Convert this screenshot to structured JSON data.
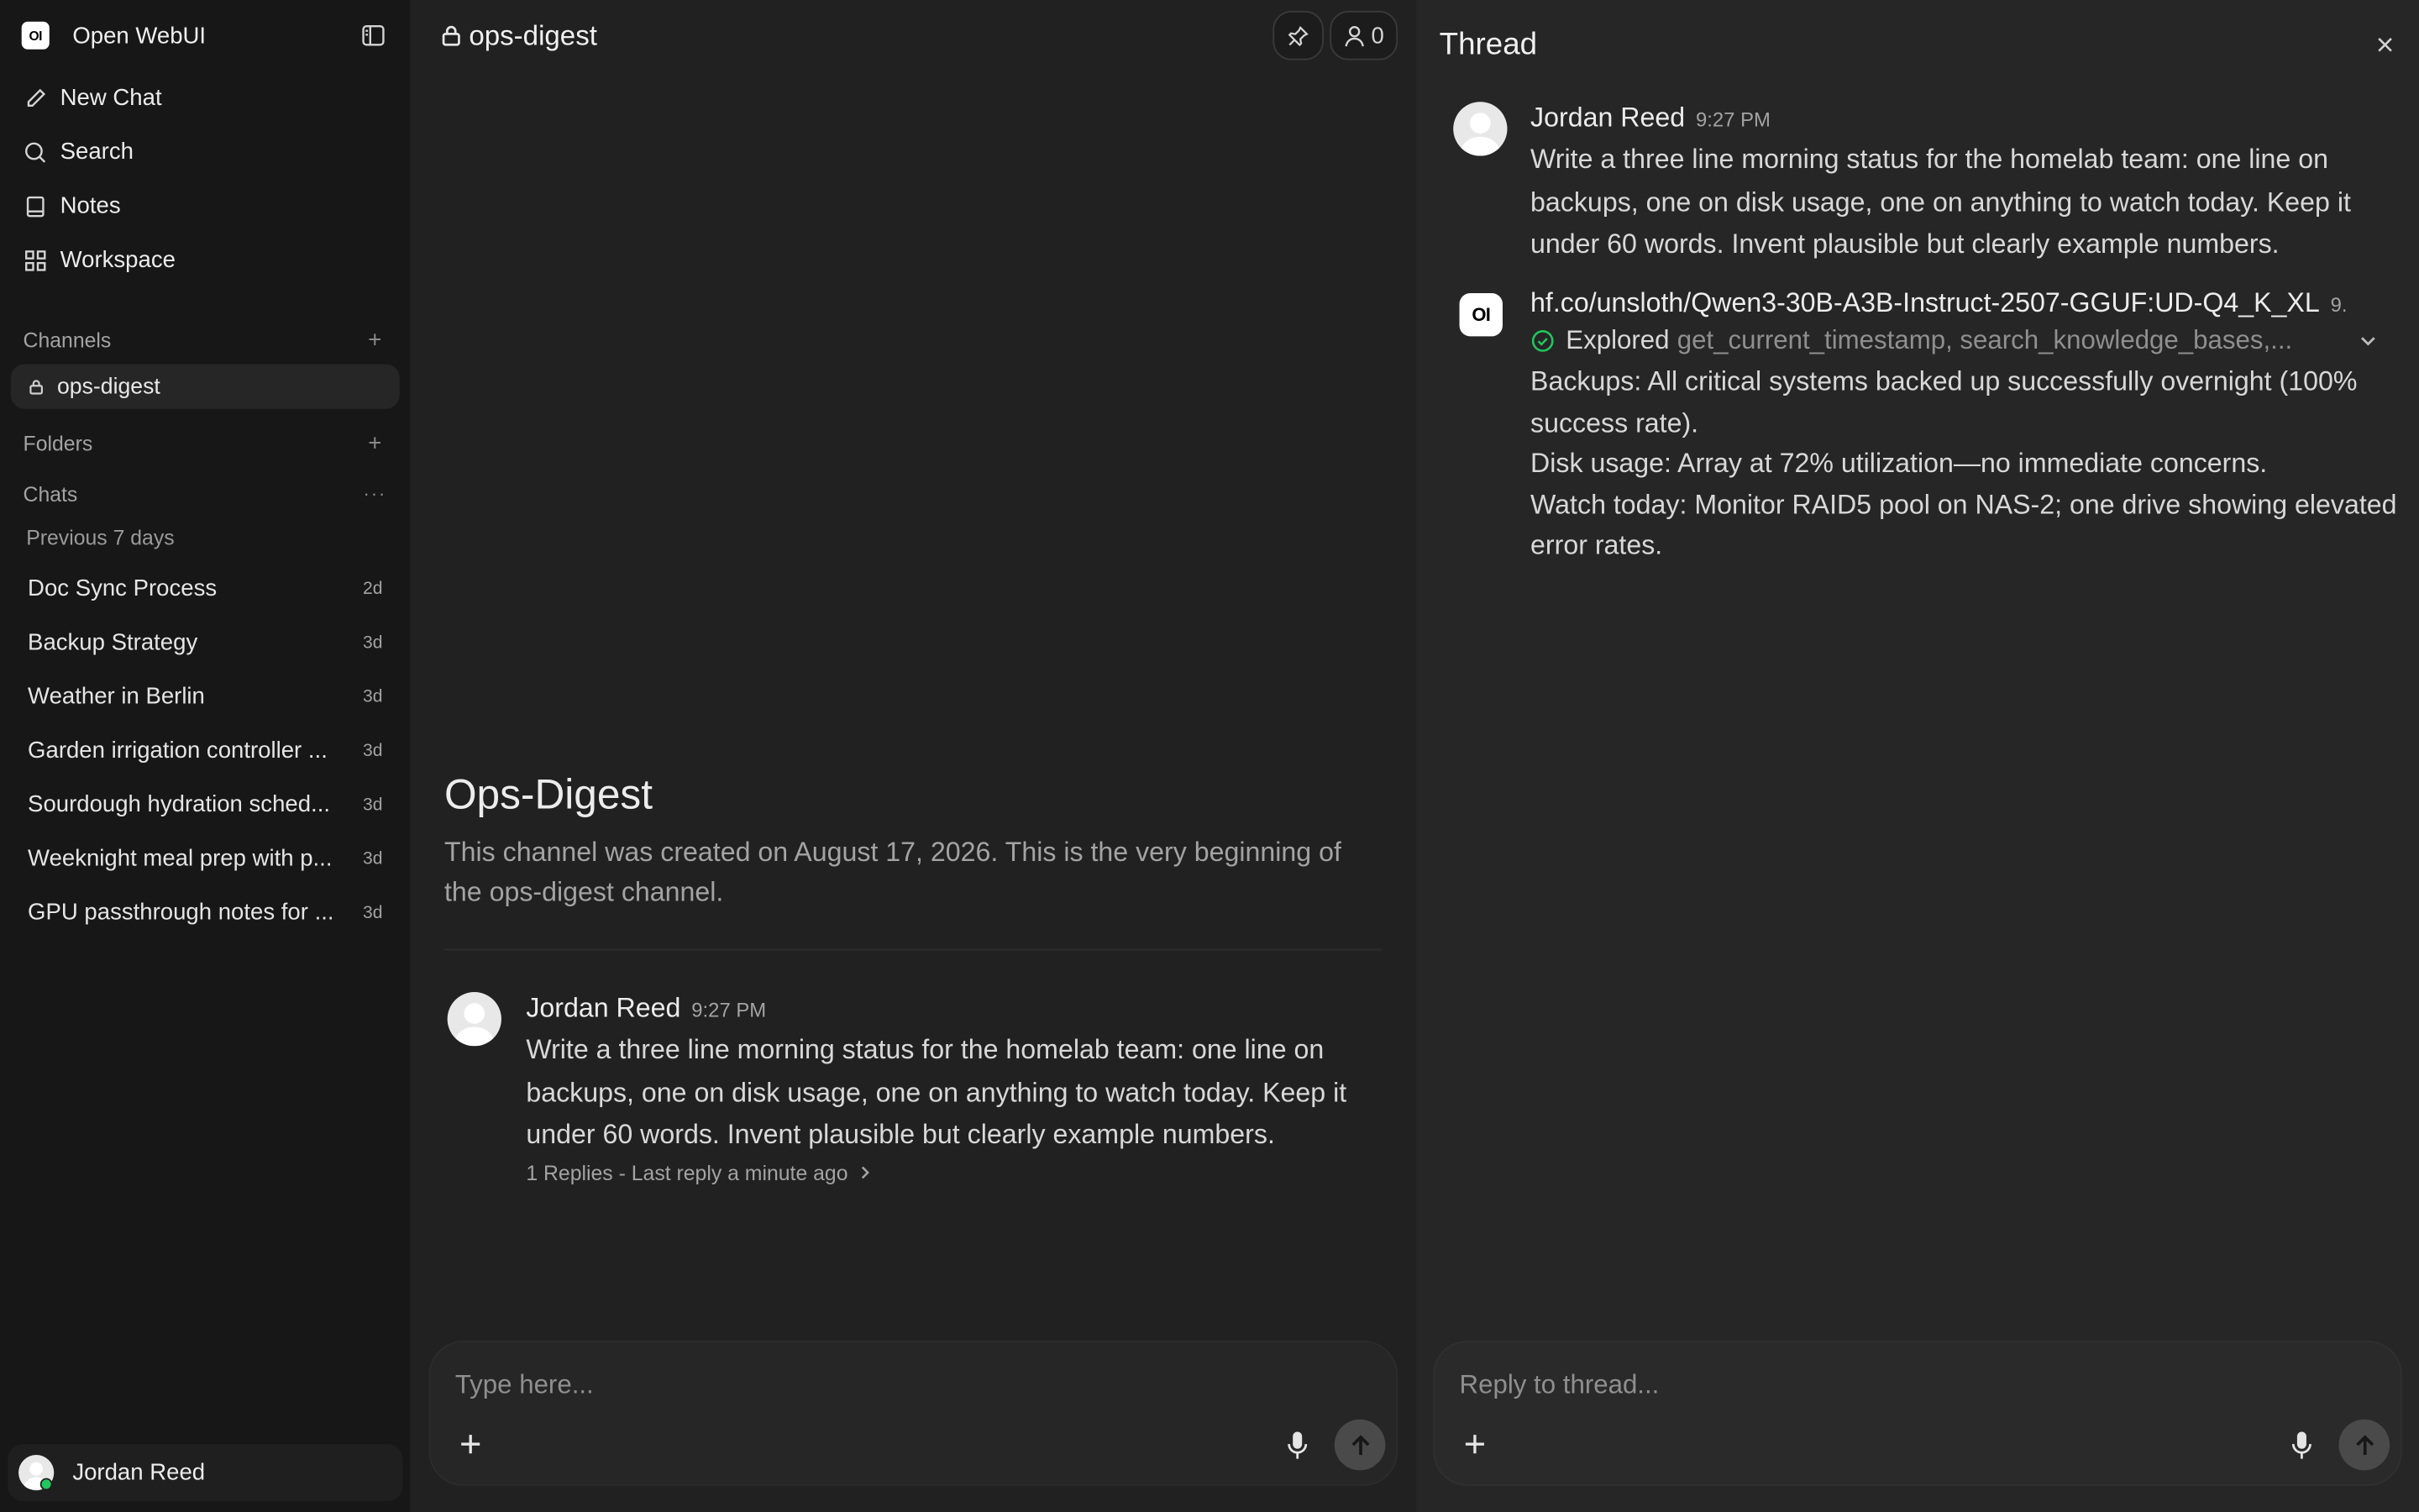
{
  "app": {
    "logo_text": "OI",
    "name": "Open WebUI"
  },
  "sidebar": {
    "nav": [
      {
        "label": "New Chat",
        "icon": "pencil-icon"
      },
      {
        "label": "Search",
        "icon": "search-icon"
      },
      {
        "label": "Notes",
        "icon": "notes-icon"
      },
      {
        "label": "Workspace",
        "icon": "workspace-icon"
      }
    ],
    "channels_label": "Channels",
    "channels": [
      {
        "label": "ops-digest"
      }
    ],
    "folders_label": "Folders",
    "chats_label": "Chats",
    "chat_group": "Previous 7 days",
    "chats": [
      {
        "title": "Doc Sync Process",
        "age": "2d"
      },
      {
        "title": "Backup Strategy",
        "age": "3d"
      },
      {
        "title": "Weather in Berlin",
        "age": "3d"
      },
      {
        "title": "Garden irrigation controller ...",
        "age": "3d"
      },
      {
        "title": "Sourdough hydration sched...",
        "age": "3d"
      },
      {
        "title": "Weeknight meal prep with p...",
        "age": "3d"
      },
      {
        "title": "GPU passthrough notes for ...",
        "age": "3d"
      }
    ],
    "user": {
      "name": "Jordan Reed",
      "status_color": "#22c55e"
    }
  },
  "channel": {
    "name": "ops-digest",
    "members_count": "0",
    "intro_title": "Ops-Digest",
    "intro_text": "This channel was created on August 17, 2026. This is the very beginning of the ops-digest channel.",
    "message": {
      "author": "Jordan Reed",
      "time": "9:27 PM",
      "lines": [
        "Write a three line morning status for the homelab team: one line on",
        "backups, one on disk usage, one on anything to watch today. Keep it",
        "under 60 words. Invent plausible but clearly example numbers."
      ],
      "replies": "1 Replies - Last reply a minute ago"
    },
    "composer_placeholder": "Type here..."
  },
  "thread": {
    "title": "Thread",
    "user_message": {
      "author": "Jordan Reed",
      "time": "9:27 PM",
      "lines": [
        "Write a three line morning status for the homelab team: one line on",
        "backups, one on disk usage, one on anything to watch today. Keep it",
        "under 60 words. Invent plausible but clearly example numbers."
      ]
    },
    "bot_message": {
      "avatar_text": "OI",
      "model": "hf.co/unsloth/Qwen3-30B-A3B-Instruct-2507-GGUF:UD-Q4_K_XL",
      "time_fragment": "9.",
      "tool_status": "Explored",
      "tools": "get_current_timestamp, search_knowledge_bases,...",
      "lines": [
        "Backups: All critical systems backed up successfully overnight (100%",
        "success rate).",
        "Disk usage: Array at 72% utilization—no immediate concerns.",
        "Watch today: Monitor RAID5 pool on NAS-2; one drive showing elevated",
        "error rates."
      ]
    },
    "composer_placeholder": "Reply to thread..."
  },
  "colors": {
    "accent_green": "#22c55e",
    "sidebar_bg": "#171717",
    "main_bg": "#212121",
    "thread_bg": "#262626"
  }
}
